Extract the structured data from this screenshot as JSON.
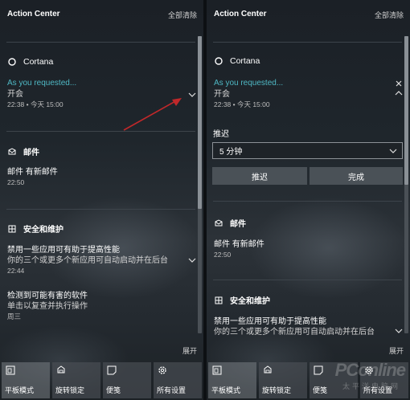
{
  "left": {
    "title": "Action Center",
    "clear_all": "全部清除",
    "cortana": {
      "app_name": "Cortana",
      "line1": "As you requested...",
      "line2": "开会",
      "time": "22:38 • 今天 15:00"
    },
    "mail": {
      "app_name": "邮件",
      "line1": "邮件 有新邮件",
      "time": "22:50"
    },
    "security": {
      "app_name": "安全和维护",
      "n1_title": "禁用一些应用可有助于提高性能",
      "n1_body": "你的三个或更多个新应用可自动启动并在后台",
      "n1_time": "22:44",
      "n2_title": "检测到可能有害的软件",
      "n2_body": "单击以复查并执行操作",
      "n2_time": "周三"
    },
    "expand": "展开",
    "quick_actions": [
      {
        "label": "平板模式",
        "icon": "tablet-mode-icon"
      },
      {
        "label": "旋转锁定",
        "icon": "rotation-lock-icon"
      },
      {
        "label": "便笺",
        "icon": "note-icon"
      },
      {
        "label": "所有设置",
        "icon": "settings-icon"
      }
    ]
  },
  "right": {
    "title": "Action Center",
    "clear_all": "全部清除",
    "cortana": {
      "app_name": "Cortana",
      "line1": "As you requested...",
      "line2": "开会",
      "time": "22:38 • 今天 15:00"
    },
    "snooze": {
      "label": "推迟",
      "selected": "5 分钟",
      "snooze_button": "推迟",
      "done_button": "完成"
    },
    "mail": {
      "app_name": "邮件",
      "line1": "邮件 有新邮件",
      "time": "22:50"
    },
    "security": {
      "app_name": "安全和维护",
      "n1_title": "禁用一些应用可有助于提高性能",
      "n1_body": "你的三个或更多个新应用可自动启动并在后台"
    },
    "expand": "展开",
    "quick_actions": [
      {
        "label": "平板模式",
        "icon": "tablet-mode-icon"
      },
      {
        "label": "旋转锁定",
        "icon": "rotation-lock-icon"
      },
      {
        "label": "便笺",
        "icon": "note-icon"
      },
      {
        "label": "所有设置",
        "icon": "settings-icon"
      }
    ],
    "watermark": "PConline",
    "watermark_sub": "太平洋电脑网"
  },
  "colors": {
    "accent": "#4fb8c4",
    "arrow_annotation": "#c0282a"
  }
}
